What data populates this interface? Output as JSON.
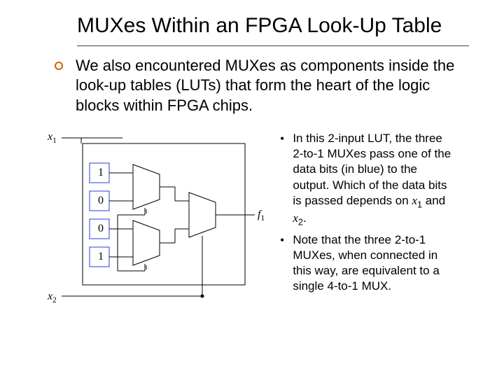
{
  "title": "MUXes Within an FPGA Look-Up Table",
  "body": "We also encountered MUXes as components inside the look-up tables (LUTs) that form the heart of the logic blocks within FPGA chips.",
  "diagram": {
    "x1_label": "x",
    "x1_sub": "1",
    "x2_label": "x",
    "x2_sub": "2",
    "f1_label": "f",
    "f1_sub": "1",
    "bits": [
      "1",
      "0",
      "0",
      "1"
    ]
  },
  "notes": [
    {
      "prefix": "In this 2-input LUT, the three 2-to-1 MUXes pass one of the data bits (in blue) to the output.  Which of the data bits is passed depends on ",
      "var1": "x",
      "sub1": "1",
      "mid": " and ",
      "var2": "x",
      "sub2": "2",
      "suffix": "."
    },
    {
      "prefix": "Note that the three 2-to-1 MUXes, when connected in this way, are equivalent to a single 4-to-1 MUX.",
      "var1": "",
      "sub1": "",
      "mid": "",
      "var2": "",
      "sub2": "",
      "suffix": ""
    }
  ]
}
